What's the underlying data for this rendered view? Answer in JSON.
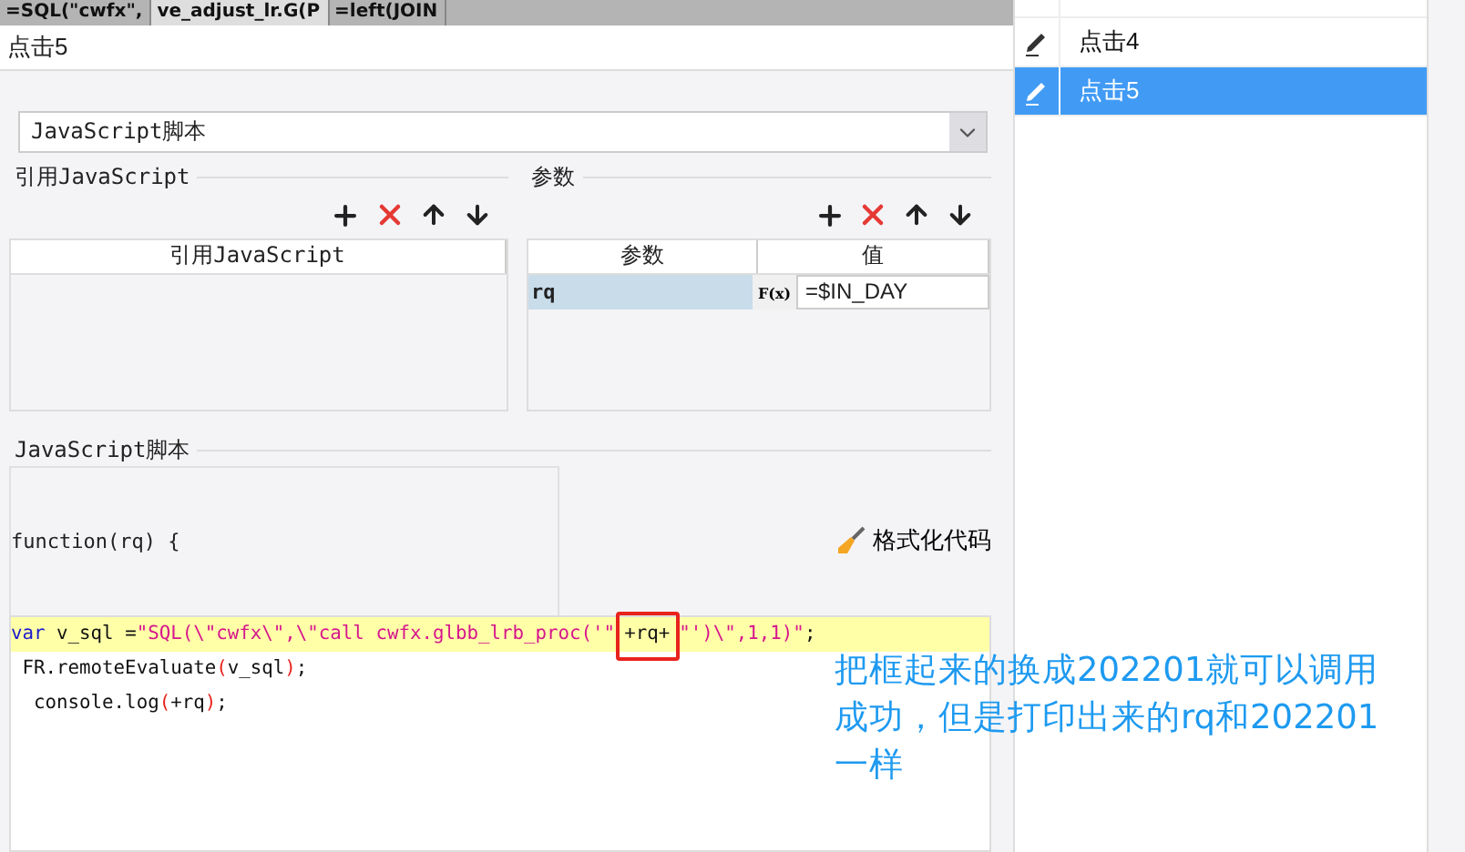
{
  "spreadsheet_strip": {
    "cells": [
      "=SQL(\"cwfx\",",
      "ve_adjust_lr.G(P",
      "=left(JOIN"
    ]
  },
  "dialog": {
    "title": "点击5",
    "script_type": "JavaScript脚本",
    "imports": {
      "title": "引用JavaScript",
      "columns": [
        "引用JavaScript"
      ]
    },
    "params": {
      "title": "参数",
      "columns": [
        "参数",
        "值"
      ],
      "rows": [
        {
          "name": "rq",
          "formula_icon": "F(x)",
          "value": "=$IN_DAY",
          "selected": true
        }
      ]
    },
    "script": {
      "title": "JavaScript脚本",
      "signature": "function(rq) {",
      "format_button": "格式化代码",
      "lines": [
        {
          "highlighted": true,
          "tokens": [
            {
              "kind": "keyword",
              "text": "var"
            },
            {
              "kind": "plain",
              "text": " v_sql ="
            },
            {
              "kind": "string",
              "text": "\"SQL(\\\"cwfx\\\",\\\"call cwfx.glbb_lrb_proc('\""
            },
            {
              "kind": "plain",
              "text": "+rq+",
              "boxed": true
            },
            {
              "kind": "string",
              "text": "\"')\\\",1,1)\""
            },
            {
              "kind": "plain",
              "text": ";"
            }
          ]
        },
        {
          "highlighted": false,
          "tokens": [
            {
              "kind": "plain",
              "text": " FR.remoteEvaluate"
            },
            {
              "kind": "paren",
              "text": "("
            },
            {
              "kind": "plain",
              "text": "v_sql"
            },
            {
              "kind": "paren",
              "text": ")"
            },
            {
              "kind": "plain",
              "text": ";"
            }
          ]
        },
        {
          "highlighted": false,
          "tokens": [
            {
              "kind": "plain",
              "text": "  console.log"
            },
            {
              "kind": "paren",
              "text": "("
            },
            {
              "kind": "plain",
              "text": "+rq"
            },
            {
              "kind": "paren",
              "text": ")"
            },
            {
              "kind": "plain",
              "text": ";"
            }
          ]
        }
      ]
    }
  },
  "events": [
    {
      "label": "点击4",
      "selected": false
    },
    {
      "label": "点击5",
      "selected": true
    }
  ],
  "annotation": "把框起来的换成202201就可以调用成功，但是打印出来的rq和202201一样"
}
